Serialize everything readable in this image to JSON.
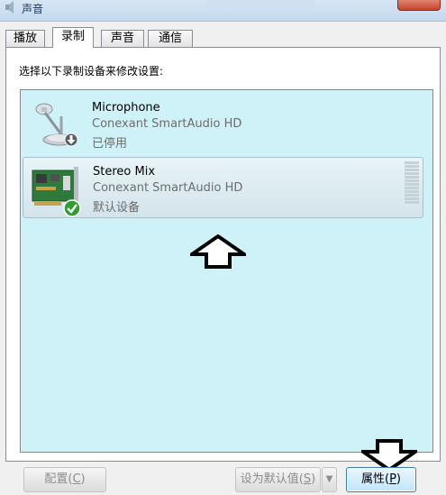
{
  "window": {
    "title": "声音"
  },
  "tabs": [
    {
      "label": "播放",
      "active": false
    },
    {
      "label": "录制",
      "active": true
    },
    {
      "label": "声音",
      "active": false
    },
    {
      "label": "通信",
      "active": false
    }
  ],
  "instruction": "选择以下录制设备来修改设置:",
  "devices": [
    {
      "name": "Microphone",
      "driver": "Conexant SmartAudio HD",
      "status": "已停用",
      "icon": "microphone-icon",
      "badge": "disabled-down-arrow-icon",
      "selected": false
    },
    {
      "name": "Stereo Mix",
      "driver": "Conexant SmartAudio HD",
      "status": "默认设备",
      "icon": "sound-card-icon",
      "badge": "default-check-icon",
      "selected": true
    }
  ],
  "buttons": {
    "configure": {
      "label": "配置(",
      "key": "C",
      "suffix": ")",
      "enabled": false
    },
    "set_default": {
      "label": "设为默认值(",
      "key": "S",
      "suffix": ")",
      "enabled": false
    },
    "set_default_dropdown": {
      "glyph": "▼"
    },
    "properties": {
      "label": "属性(",
      "key": "P",
      "suffix": ")",
      "enabled": true
    }
  },
  "colors": {
    "list_background": "#cff2f8",
    "selected_row": "#d3e4ea",
    "check_green": "#2f9e2f"
  }
}
